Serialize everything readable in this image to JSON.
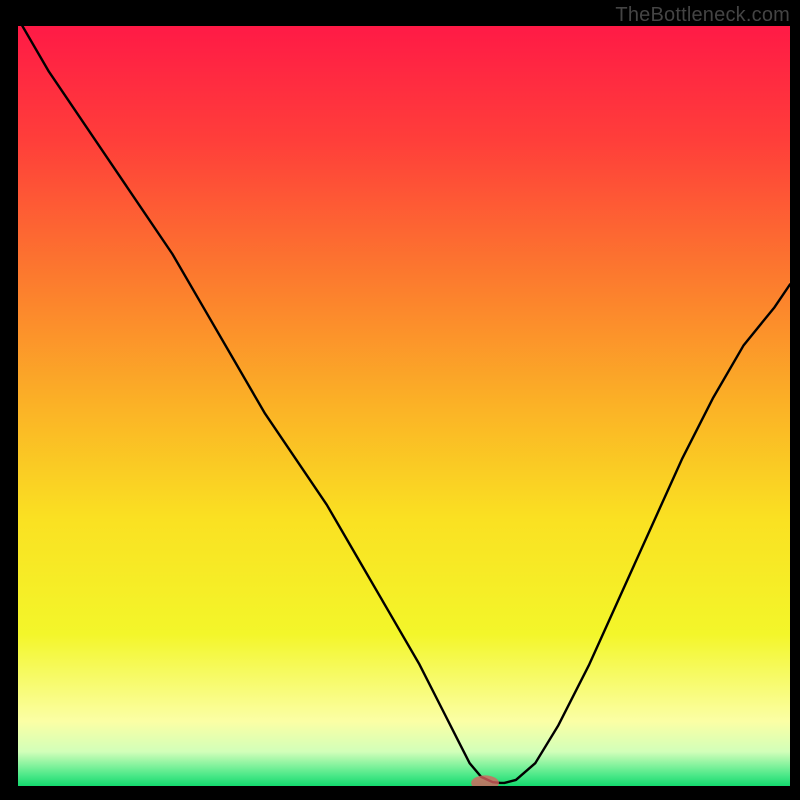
{
  "watermark": "TheBottleneck.com",
  "colors": {
    "bg": "#000000",
    "gradient_stops": [
      {
        "offset": 0.0,
        "color": "#ff1a46"
      },
      {
        "offset": 0.15,
        "color": "#ff3e3a"
      },
      {
        "offset": 0.33,
        "color": "#fc7a2e"
      },
      {
        "offset": 0.5,
        "color": "#fbb226"
      },
      {
        "offset": 0.65,
        "color": "#fae122"
      },
      {
        "offset": 0.8,
        "color": "#f3f62a"
      },
      {
        "offset": 0.915,
        "color": "#fbffa5"
      },
      {
        "offset": 0.955,
        "color": "#d2ffb9"
      },
      {
        "offset": 0.985,
        "color": "#4fe98a"
      },
      {
        "offset": 1.0,
        "color": "#14d96e"
      }
    ],
    "curve": "#000000",
    "marker": "rgba(220,95,95,0.78)"
  },
  "chart_data": {
    "type": "line",
    "title": "",
    "xlabel": "",
    "ylabel": "",
    "xlim": [
      0,
      100
    ],
    "ylim": [
      0,
      100
    ],
    "grid": false,
    "x": [
      0,
      4,
      8,
      12,
      16,
      20,
      24,
      28,
      32,
      36,
      40,
      44,
      48,
      52,
      55,
      57,
      58.5,
      60,
      61.5,
      62.5,
      63,
      64.5,
      67,
      70,
      74,
      78,
      82,
      86,
      90,
      94,
      98,
      100
    ],
    "values": [
      101,
      94,
      88,
      82,
      76,
      70,
      63,
      56,
      49,
      43,
      37,
      30,
      23,
      16,
      10,
      6,
      3,
      1.2,
      0.5,
      0.4,
      0.4,
      0.8,
      3,
      8,
      16,
      25,
      34,
      43,
      51,
      58,
      63,
      66
    ],
    "flat_segment_x": [
      57.5,
      63
    ],
    "marker": {
      "x": 60.5,
      "y": 0.4,
      "rx": 1.8,
      "ry": 1.0
    }
  }
}
